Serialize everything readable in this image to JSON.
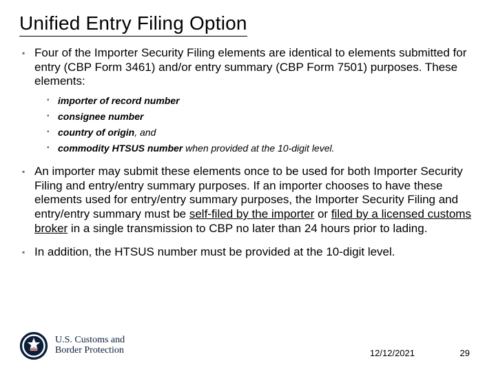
{
  "title": "Unified Entry Filing Option",
  "bullets": {
    "b1": "Four of the Importer Security Filing elements are identical to elements submitted for entry (CBP Form 3461) and/or entry summary (CBP Form 7501) purposes. These elements:",
    "sub1": "importer of record number",
    "sub2": "consignee number",
    "sub3a": "country of origin",
    "sub3b": ", and",
    "sub4a": "commodity HTSUS number",
    "sub4b": " when provided at the 10-digit level.",
    "b2a": "An importer may submit these elements once to be used for both Importer Security Filing and entry/entry summary purposes. If an importer chooses to have these elements used for entry/entry summary purposes, the Importer Security Filing and entry/entry summary must be ",
    "b2u1": "self-filed by the importer",
    "b2mid": " or ",
    "b2u2": "filed by a licensed customs broker",
    "b2b": " in a single transmission to CBP no later than 24 hours prior to lading.",
    "b3": "In addition, the HTSUS number must be provided at the 10-digit level."
  },
  "footer": {
    "agency_line1": "U.S. Customs and",
    "agency_line2": "Border Protection",
    "date": "12/12/2021",
    "page": "29"
  }
}
